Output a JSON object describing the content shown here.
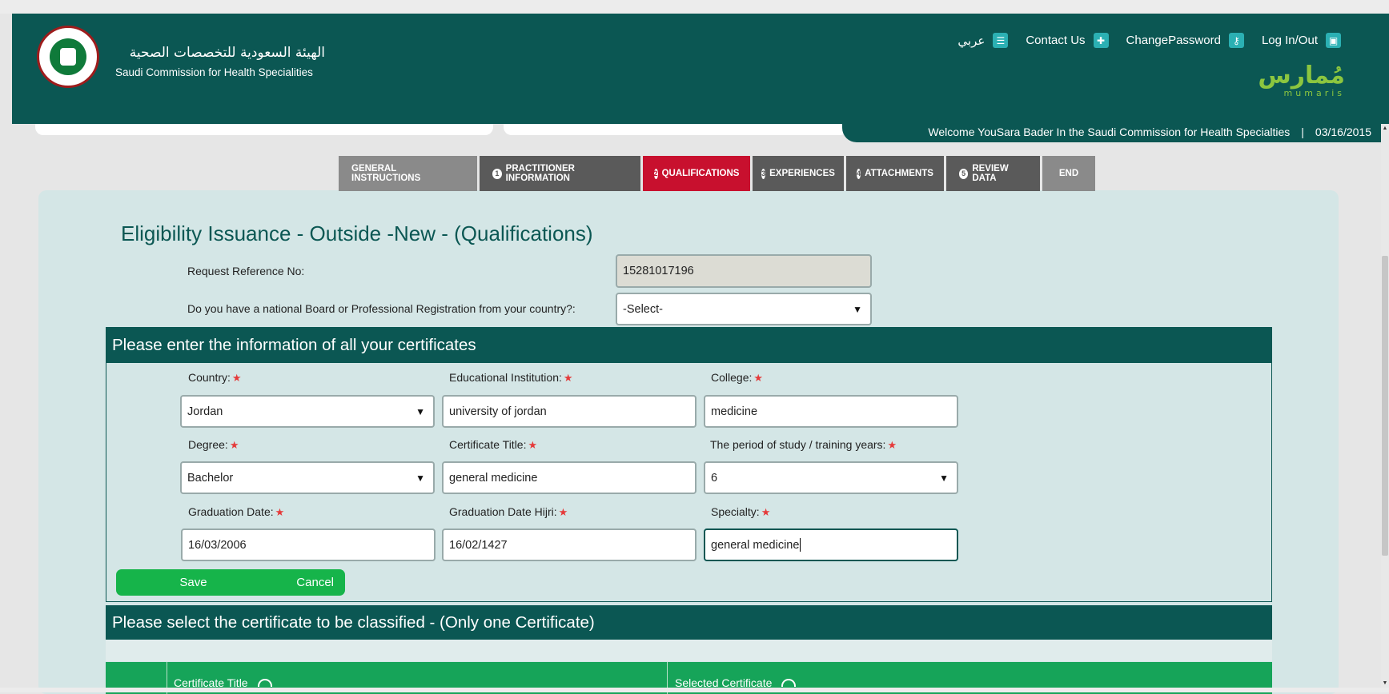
{
  "header": {
    "org_name_ar": "الهيئة السعودية للتخصصات الصحية",
    "org_name_en": "Saudi Commission for Health Specialities",
    "links": {
      "arabic": "عربي",
      "contact": "Contact Us",
      "change_password": "ChangePassword",
      "login": "Log In/Out"
    },
    "brand_ar": "مُمارس",
    "brand_en": "mumaris"
  },
  "welcome": {
    "message": "Welcome YouSara Bader In the Saudi Commission for Health Specialties",
    "separator": "|",
    "date": "03/16/2015"
  },
  "steps": [
    {
      "num": "",
      "label": "GENERAL INSTRUCTIONS"
    },
    {
      "num": "1",
      "label": "PRACTITIONER INFORMATION"
    },
    {
      "num": "2",
      "label": "QUALIFICATIONS"
    },
    {
      "num": "3",
      "label": "EXPERIENCES"
    },
    {
      "num": "4",
      "label": "ATTACHMENTS"
    },
    {
      "num": "5",
      "label": "REVIEW DATA"
    },
    {
      "num": "",
      "label": "END"
    }
  ],
  "page": {
    "title": "Eligibility Issuance - Outside -New - (Qualifications)",
    "ref_label": "Request Reference No:",
    "ref_value": "15281017196",
    "board_label": "Do you have a national Board or Professional Registration from your country?:",
    "board_value": "-Select-"
  },
  "certificates": {
    "header": "Please enter the information of all your certificates",
    "required_mark": "★",
    "country_label": "Country:",
    "country_value": "Jordan",
    "institution_label": "Educational Institution:",
    "institution_value": "university of jordan",
    "college_label": "College:",
    "college_value": "medicine",
    "degree_label": "Degree:",
    "degree_value": "Bachelor",
    "cert_title_label": "Certificate Title:",
    "cert_title_value": "general medicine",
    "period_label": "The period of study / training years:",
    "period_value": "6",
    "grad_date_label": "Graduation Date:",
    "grad_date_value": "16/03/2006",
    "grad_hijri_label": "Graduation Date Hijri:",
    "grad_hijri_value": "16/02/1427",
    "specialty_label": "Specialty:",
    "specialty_value": "general medicine",
    "save": "Save",
    "cancel": "Cancel"
  },
  "classify": {
    "header": "Please select the certificate to be classified - (Only one Certificate)",
    "col_cert_title": "Certificate Title",
    "col_selected": "Selected Certificate"
  }
}
